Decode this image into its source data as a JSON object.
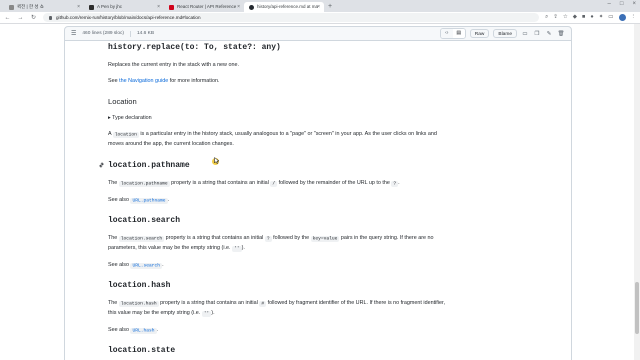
{
  "tabs": [
    {
      "label": "퀵전 | 한 성 쇼",
      "active": false
    },
    {
      "label": "A Pen by jhc",
      "active": false
    },
    {
      "label": "React Router | API Reference",
      "active": false
    },
    {
      "label": "history/api-reference.md at ma",
      "active": true
    }
  ],
  "address": {
    "url": "github.com/remix-run/history/blob/main/docs/api-reference.md#location"
  },
  "file_header": {
    "stats": "460 lines (289 sloc)",
    "size": "14.6 KB",
    "raw_label": "Raw",
    "blame_label": "Blame"
  },
  "doc": {
    "replace_heading": "history.replace(to: To, state?: any)",
    "replace_desc": "Replaces the current entry in the stack with a new one.",
    "see_pre": "See ",
    "nav_link": "the Navigation guide",
    "see_post": " for more information.",
    "location_heading": "Location",
    "type_decl": "Type declaration",
    "location_p1_pre": "A ",
    "location_code": "location",
    "location_p1_post": " is a particular entry in the history stack, usually analogous to a \"page\" or \"screen\" in your app. As the user clicks on links and",
    "location_p1_line2": "moves around the app, the current location changes.",
    "pathname_heading": "location.pathname",
    "pathname_p_pre": "The ",
    "pathname_code": "location.pathname",
    "pathname_p_mid": " property is a string that contains an initial ",
    "pathname_slash": "/",
    "pathname_p_mid2": " followed by the remainder of the URL up to the ",
    "pathname_q": "?",
    "pathname_p_end": ".",
    "see_also": "See also ",
    "pathname_see": "URL.pathname",
    "dot": ".",
    "search_heading": "location.search",
    "search_p_pre": "The ",
    "search_code": "location.search",
    "search_p_mid": " property is a string that contains an initial ",
    "search_q": "?",
    "search_p_mid2": " followed by the ",
    "search_kv": "key=value",
    "search_p_end": " pairs in the query string. If there are no",
    "search_p_line2_pre": "parameters, this value may be the empty string (i.e. ",
    "empty_code": "''",
    "search_p_line2_end": ").",
    "search_see": "URL.search",
    "hash_heading": "location.hash",
    "hash_p_pre": "The ",
    "hash_code": "location.hash",
    "hash_p_mid": " property is a string that contains an initial ",
    "hash_sym": "#",
    "hash_p_end": " followed by fragment identifier of the URL. If there is no fragment identifier,",
    "hash_p_line2_pre": "this value may be the empty string (i.e. ",
    "hash_p_line2_end": ").",
    "hash_see": "URL.hash",
    "state_heading": "location.state"
  },
  "colors": {
    "link": "#0969da",
    "text": "#1f2328",
    "code_bg": "#eff1f3"
  },
  "scroll": {
    "position_fraction": 0.77
  }
}
